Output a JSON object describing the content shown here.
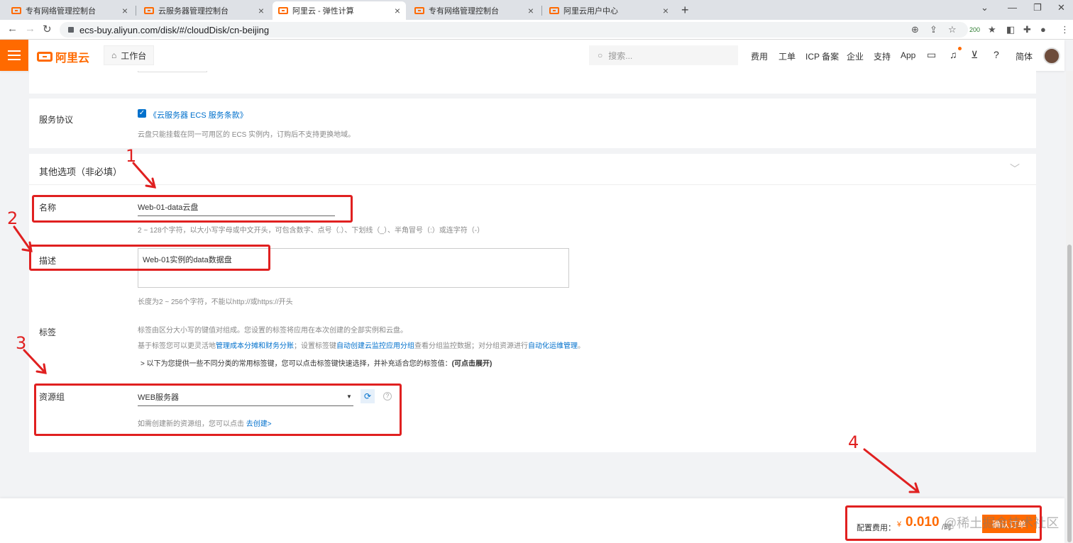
{
  "browser": {
    "tabs": [
      {
        "title": "专有网络管理控制台"
      },
      {
        "title": "云服务器管理控制台"
      },
      {
        "title": "阿里云 - 弹性计算"
      },
      {
        "title": "专有网络管理控制台"
      },
      {
        "title": "阿里云用户中心"
      }
    ],
    "url": "ecs-buy.aliyun.com/disk/#/cloudDisk/cn-beijing"
  },
  "topbar": {
    "logo_text": "阿里云",
    "workbench_label": "工作台",
    "search_placeholder": "搜索...",
    "nav_items": [
      "费用",
      "工单",
      "ICP 备案",
      "企业",
      "支持",
      "App"
    ],
    "language": "简体"
  },
  "agreement": {
    "label": "服务协议",
    "checkbox_link": "《云服务器 ECS 服务条款》",
    "note": "云盘只能挂载在同一可用区的 ECS 实例内，订购后不支持更换地域。"
  },
  "other_options": {
    "title": "其他选项（非必填）"
  },
  "name_field": {
    "label": "名称",
    "value": "Web-01-data云盘",
    "help": "2 ~ 128个字符，以大小写字母或中文开头，可包含数字、点号（.）、下划线（_）、半角冒号（:）或连字符（-）"
  },
  "desc_field": {
    "label": "描述",
    "value": "Web-01实例的data数据盘",
    "help": "长度为2 ~ 256个字符，不能以http://或https://开头"
  },
  "tags": {
    "label": "标签",
    "line1": "标签由区分大小写的键值对组成。您设置的标签将应用在本次创建的全部实例和云盘。",
    "line2_prefix": "基于标签您可以更灵活地",
    "line2_link1": "管理成本分摊和财务分账",
    "line2_mid": "；设置标签键",
    "line2_link2": "自动创建云监控应用分组",
    "line2_mid2": "查看分组监控数据；对分组资源进行",
    "line2_link3": "自动化运维管理",
    "line2_end": "。",
    "expand_text": "以下为您提供一些不同分类的常用标签键，您可以点击标签键快速选择，并补充适合您的标签值：",
    "expand_bold": "(可点击展开)"
  },
  "resource_group": {
    "label": "资源组",
    "value": "WEB服务器",
    "help_prefix": "如需创建新的资源组，您可以点击 ",
    "create_link": "去创建>"
  },
  "footer": {
    "fee_label": "配置费用：",
    "currency": "¥",
    "amount": "0.010",
    "unit": "/时",
    "buy_button": "确认订单",
    "watermark": "@稀土掘金技术社区"
  },
  "annotations": [
    "1",
    "2",
    "3",
    "4"
  ],
  "colors": {
    "brand": "#ff6a00",
    "link": "#0070cc",
    "annotation": "#e02020"
  }
}
